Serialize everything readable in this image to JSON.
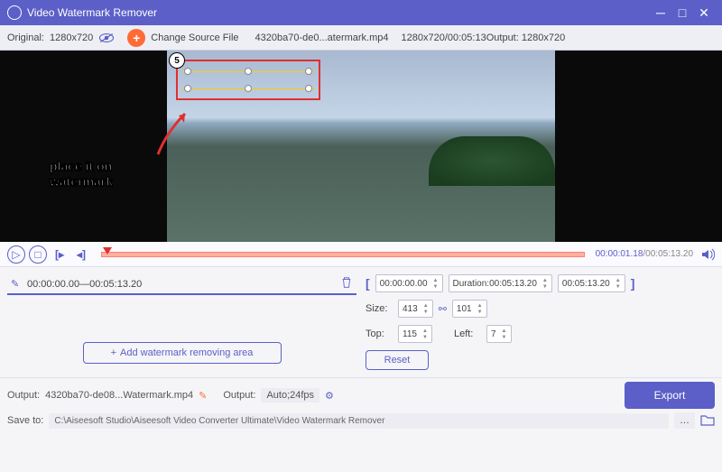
{
  "app": {
    "title": "Video Watermark Remover"
  },
  "toolbar": {
    "original_label": "Original:",
    "original_res": "1280x720",
    "change_source": "Change Source File",
    "filename": "4320ba70-de0...atermark.mp4",
    "fileinfo": "1280x720/00:05:13",
    "output_label": "Output:",
    "output_res": "1280x720"
  },
  "preview": {
    "badge": "5",
    "hint1": "place it on",
    "hint2": "watermark"
  },
  "playback": {
    "current": "00:00:01.18",
    "sep": "/",
    "duration": "00:05:13.20"
  },
  "segment": {
    "start": "00:00:00.00",
    "sep": " — ",
    "end": "00:05:13.20"
  },
  "range": {
    "start": "00:00:00.00",
    "duration_label": "Duration:",
    "duration": "00:05:13.20",
    "end": "00:05:13.20"
  },
  "size": {
    "label": "Size:",
    "width": "413",
    "height": "101"
  },
  "pos": {
    "top_label": "Top:",
    "top": "115",
    "left_label": "Left:",
    "left": "7"
  },
  "buttons": {
    "add_area": "Add watermark removing area",
    "reset": "Reset",
    "export": "Export"
  },
  "footer": {
    "output_label": "Output:",
    "output_file": "4320ba70-de08...Watermark.mp4",
    "settings_label": "Output:",
    "settings_val": "Auto;24fps",
    "saveto_label": "Save to:",
    "path": "C:\\Aiseesoft Studio\\Aiseesoft Video Converter Ultimate\\Video Watermark Remover"
  }
}
